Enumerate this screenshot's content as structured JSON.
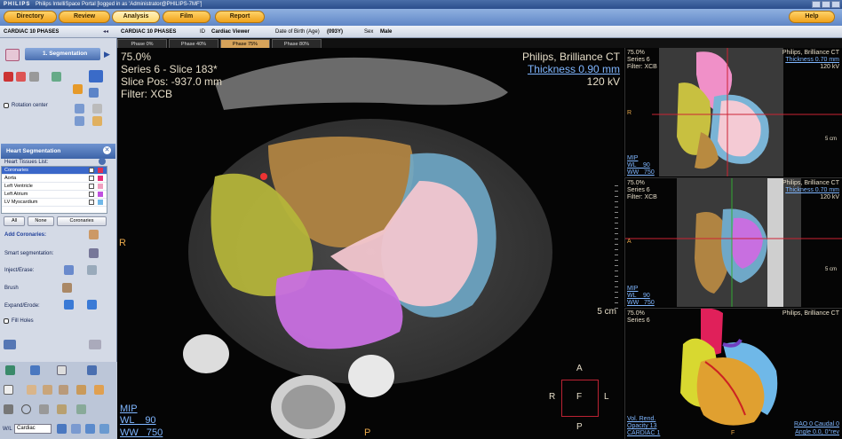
{
  "window": {
    "brand": "PHILIPS",
    "title": "Philips IntelliSpace Portal [logged in as 'Administrator@PHILIPS-7MF']"
  },
  "nav": {
    "directory": "Directory",
    "review": "Review",
    "analysis": "Analysis",
    "film": "Film",
    "report": "Report",
    "help": "Help"
  },
  "subbar": {
    "app": "CARDIAC 10 PHASES",
    "collapse": "◂◂",
    "study": "CARDIAC 10 PHASES",
    "id_label": "ID",
    "viewer": "Cardiac Viewer",
    "dob_label": "Date of Birth (Age)",
    "age": "(093Y)",
    "sex_label": "Sex",
    "sex": "Male"
  },
  "phases": [
    "Phase 0%",
    "Phase 40%",
    "Phase 75%",
    "Phase 80%"
  ],
  "sidebar": {
    "step": "1. Segmentation",
    "rotation_center": "Rotation center",
    "panel_title": "Heart Segmentation",
    "tissues_label": "Heart Tissues List:",
    "tissues": [
      {
        "name": "Coronaries",
        "color": "#e03050"
      },
      {
        "name": "Aorta",
        "color": "#e8307a"
      },
      {
        "name": "Left Ventricle",
        "color": "#f0a0c0"
      },
      {
        "name": "Left Atrium",
        "color": "#c050e0"
      },
      {
        "name": "LV Myscardium",
        "color": "#70b8e8"
      }
    ],
    "btn_all": "All",
    "btn_none": "None",
    "btn_coronaries": "Coronaries",
    "add_coronaries": "Add Coronaries:",
    "smart_seg": "Smart segmentation:",
    "inject": "Inject/Erase:",
    "brush": "Brush",
    "expand": "Expand/Erode:",
    "fill_holes": "Fill Holes",
    "wl_label": "W/L",
    "wl_value": "Cardiac"
  },
  "main_view": {
    "zoom": "75.0%",
    "series": "Series 6 - Slice 183*",
    "slice_pos": "Slice Pos: -937.0 mm",
    "filter": "Filter: XCB",
    "vendor": "Philips, Brilliance CT",
    "thickness": "Thickness 0.90 mm",
    "kv": "120 kV",
    "left_marker": "R",
    "bottom_marker": "P",
    "scale": "5 cm",
    "mip": "MIP",
    "wl": "WL    90",
    "ww": "WW   750",
    "orient": {
      "a": "A",
      "r": "R",
      "f": "F",
      "l": "L",
      "p": "P"
    }
  },
  "view_tr": {
    "zoom": "75.0%",
    "series": "Series 6",
    "filter": "Filter: XCB",
    "vendor": "Philips, Brilliance CT",
    "thickness": "Thickness 0.70 mm",
    "kv": "120 kV",
    "marker": "R",
    "mip": "MIP",
    "wl": "WL    90",
    "ww": "WW   750",
    "scale": "5 cm"
  },
  "view_mr": {
    "zoom": "75.0%",
    "series": "Series 6",
    "filter": "Filter: XCB",
    "vendor": "Philips, Brilliance CT",
    "thickness": "Thickness 0.70 mm",
    "kv": "120 kV",
    "marker": "A",
    "mip": "MIP",
    "wl": "WL    90",
    "ww": "WW   750",
    "scale": "5 cm"
  },
  "view_br": {
    "zoom": "75.0%",
    "series": "Series 6",
    "vendor": "Philips, Brilliance CT",
    "render": "Vol. Rend.",
    "opacity": "Opacity 13",
    "study": "CARDIAC 1",
    "angle1": "RAO 0 Caudal 0",
    "angle2": "Angle 0.0, 0°rev",
    "marker": "F"
  }
}
